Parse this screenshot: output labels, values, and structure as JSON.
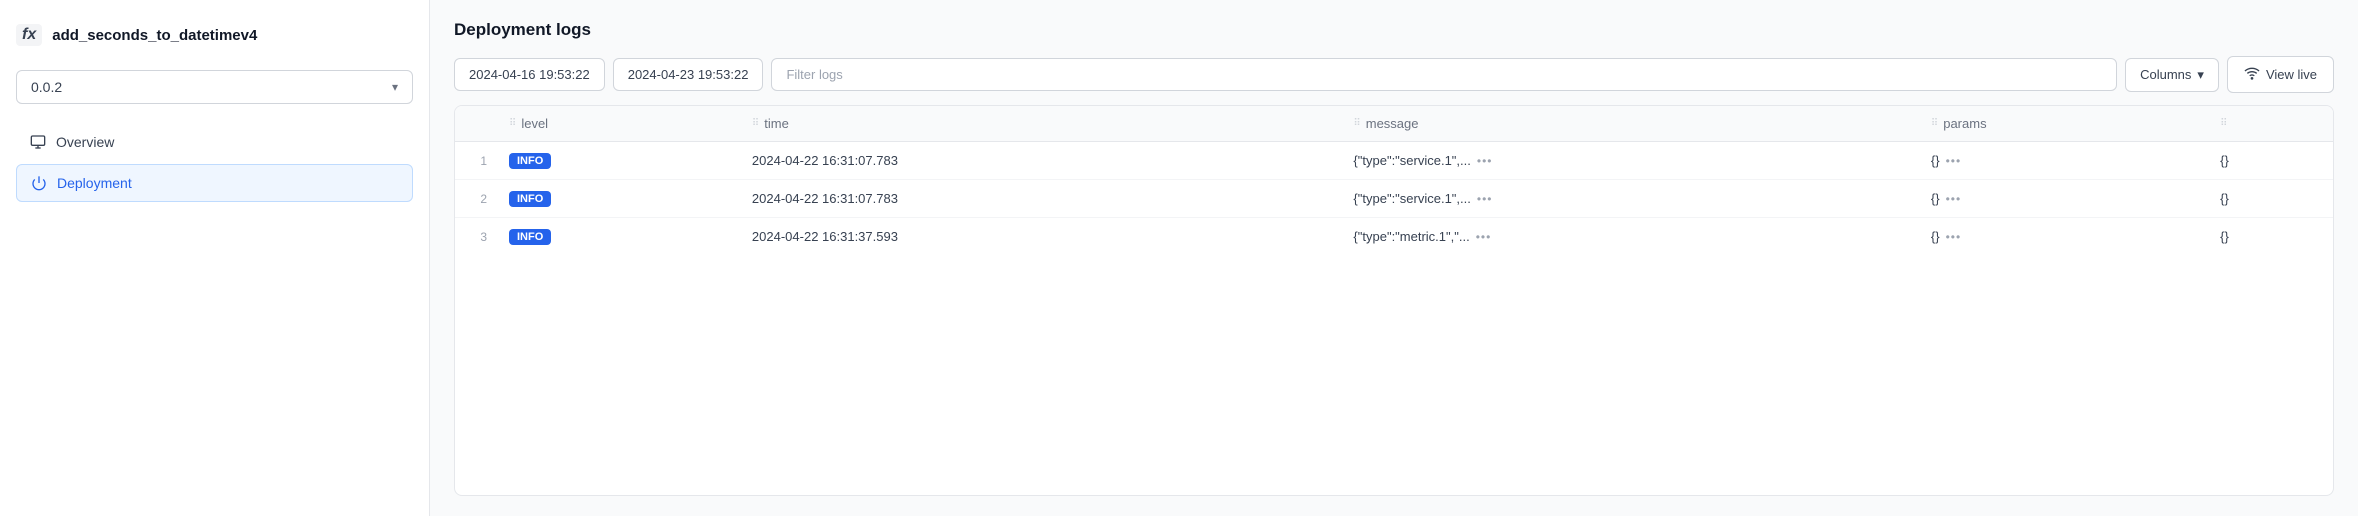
{
  "sidebar": {
    "fx_icon": "fx",
    "function_name": "add_seconds_to_datetimev4",
    "version": "0.0.2",
    "version_dropdown_aria": "Version selector",
    "nav_items": [
      {
        "id": "overview",
        "label": "Overview",
        "icon": "monitor",
        "active": false
      },
      {
        "id": "deployment",
        "label": "Deployment",
        "icon": "power",
        "active": true
      }
    ]
  },
  "main": {
    "section_title": "Deployment logs",
    "toolbar": {
      "date_start": "2024-04-16 19:53:22",
      "date_end": "2024-04-23 19:53:22",
      "filter_placeholder": "Filter logs",
      "columns_label": "Columns",
      "view_live_label": "View live"
    },
    "table": {
      "columns": [
        {
          "id": "row_num",
          "label": ""
        },
        {
          "id": "level",
          "label": "level"
        },
        {
          "id": "time",
          "label": "time"
        },
        {
          "id": "message",
          "label": "message"
        },
        {
          "id": "params",
          "label": "params"
        },
        {
          "id": "extra",
          "label": ""
        }
      ],
      "rows": [
        {
          "num": "1",
          "level": "INFO",
          "time": "2024-04-22 16:31:07.783",
          "message": "{\"type\":\"service.1\",...",
          "params": "{}",
          "extra": "{}"
        },
        {
          "num": "2",
          "level": "INFO",
          "time": "2024-04-22 16:31:07.783",
          "message": "{\"type\":\"service.1\",...",
          "params": "{}",
          "extra": "{}"
        },
        {
          "num": "3",
          "level": "INFO",
          "time": "2024-04-22 16:31:37.593",
          "message": "{\"type\":\"metric.1\",\"...",
          "params": "{}",
          "extra": "{}"
        }
      ]
    }
  },
  "icons": {
    "chevron_down": "▾",
    "grip": "⠿",
    "wifi": "📶",
    "monitor": "🖥",
    "power": "⏻",
    "ellipsis": "•••"
  }
}
